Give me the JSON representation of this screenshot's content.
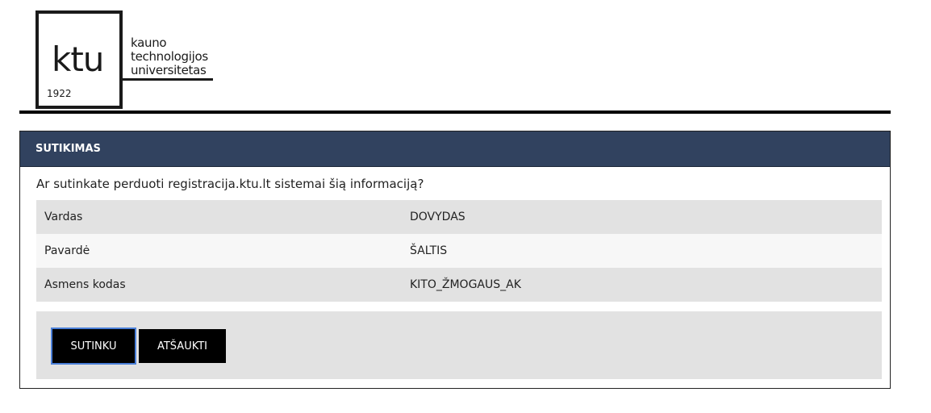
{
  "logo": {
    "monogram": "ktu",
    "year": "1922",
    "name_lines": [
      "kauno",
      "technologijos",
      "universitetas"
    ]
  },
  "panel": {
    "title": "SUTIKIMAS",
    "question": "Ar sutinkate perduoti registracija.ktu.lt sistemai šią informaciją?",
    "rows": [
      {
        "label": "Vardas",
        "value": "DOVYDAS"
      },
      {
        "label": "Pavardė",
        "value": "ŠALTIS"
      },
      {
        "label": "Asmens kodas",
        "value": "KITO_ŽMOGAUS_AK"
      }
    ]
  },
  "actions": {
    "agree_label": "SUTINKU",
    "cancel_label": "ATŠAUKTI"
  },
  "colors": {
    "header_bg": "#31425f",
    "button_bg": "#000000",
    "focus_ring": "#4a7fd8"
  }
}
